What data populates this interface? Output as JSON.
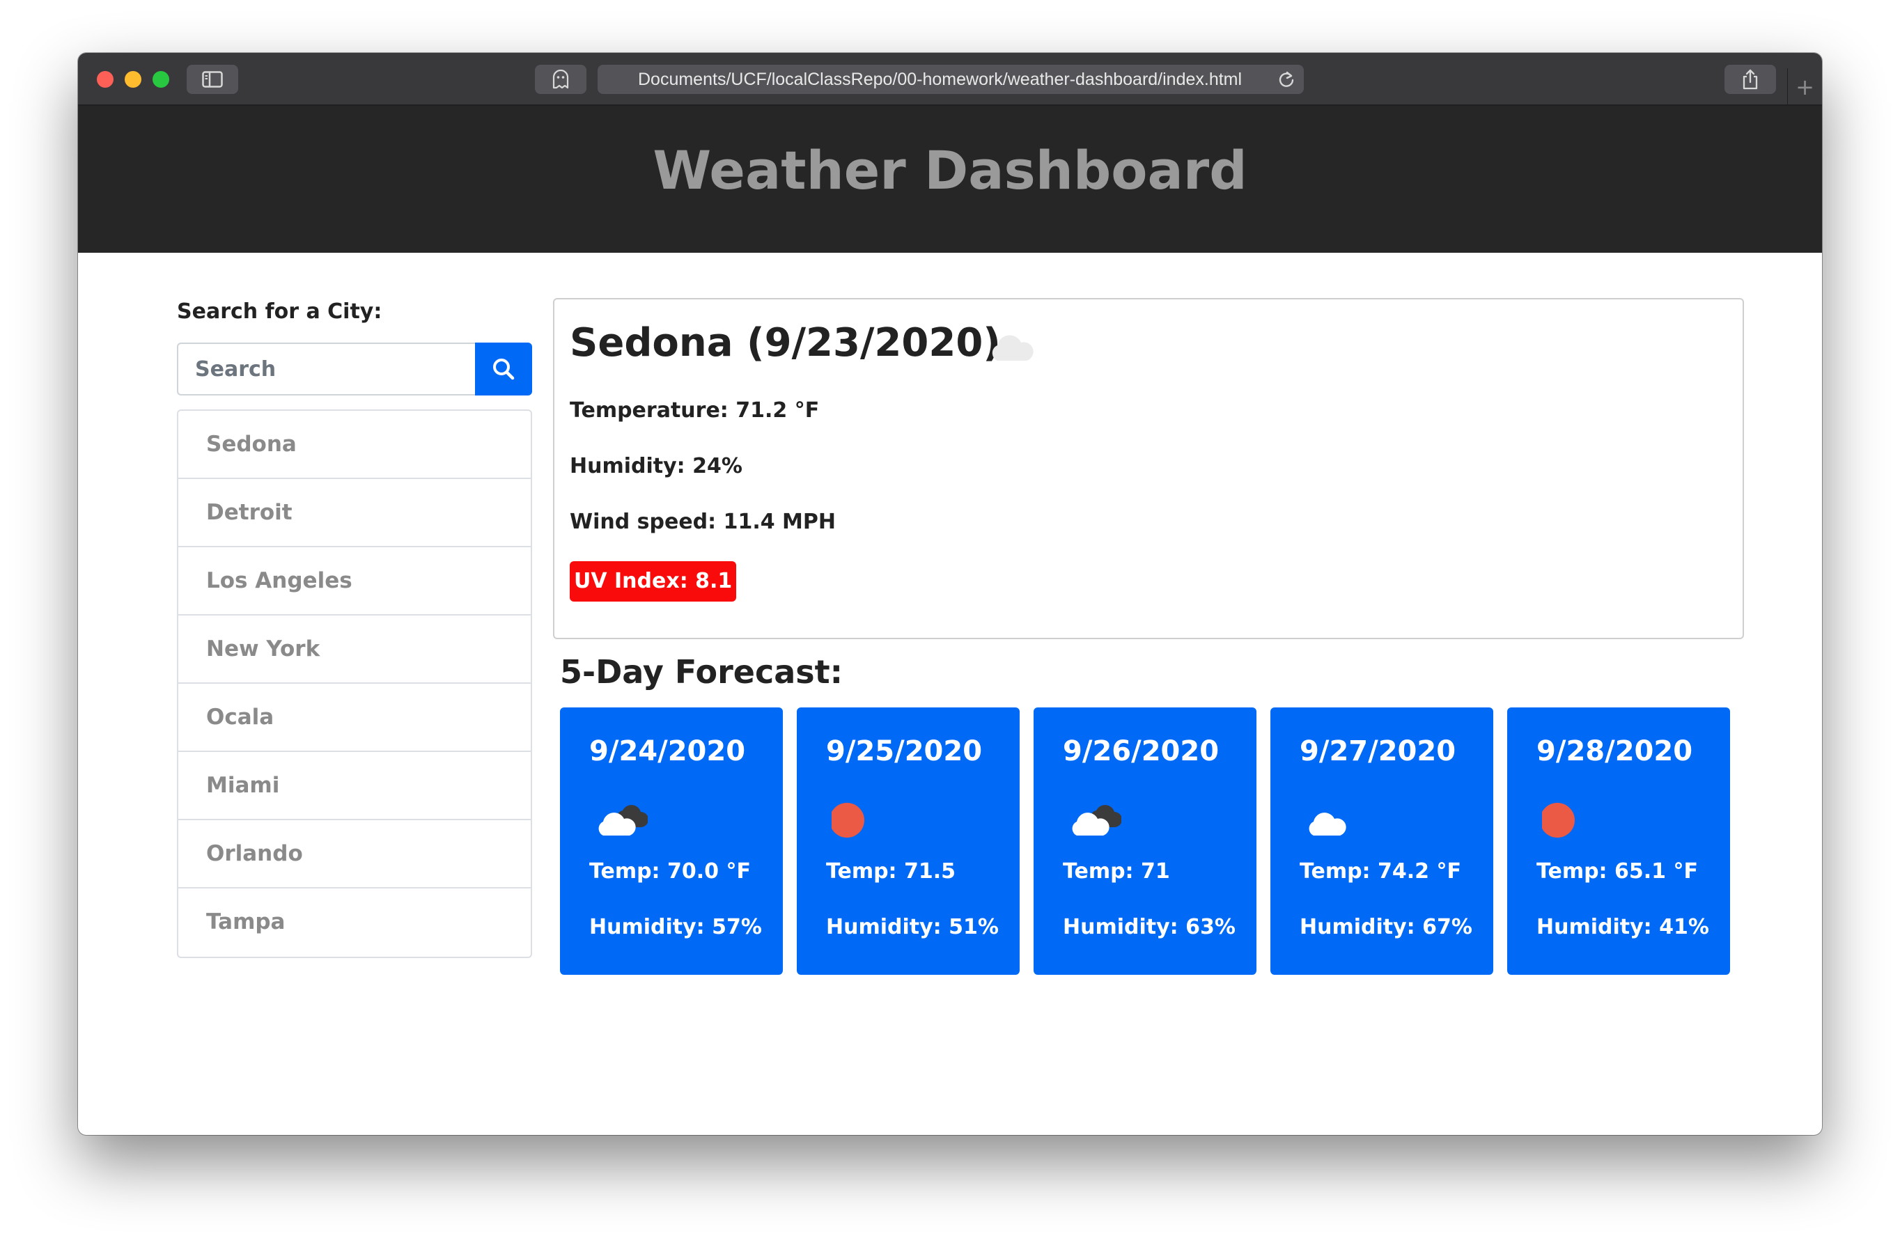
{
  "browser": {
    "url": "Documents/UCF/localClassRepo/00-homework/weather-dashboard/index.html",
    "new_tab_label": "+"
  },
  "header": {
    "title": "Weather Dashboard"
  },
  "search": {
    "label": "Search for a City:",
    "placeholder": "Search"
  },
  "cities": [
    "Sedona",
    "Detroit",
    "Los Angeles",
    "New York",
    "Ocala",
    "Miami",
    "Orlando",
    "Tampa"
  ],
  "current": {
    "title": "Sedona (9/23/2020)",
    "icon": "cloud-icon",
    "temperature": "Temperature: 71.2 °F",
    "humidity": "Humidity: 24%",
    "wind": "Wind speed: 11.4 MPH",
    "uv": "UV Index: 8.1",
    "uv_color": "#f90b0b"
  },
  "forecast": {
    "heading": "5-Day Forecast:",
    "card_color": "#0069f5",
    "days": [
      {
        "date": "9/24/2020",
        "icon": "cloudy-icon",
        "temp": "Temp: 70.0 °F",
        "humidity": "Humidity: 57%"
      },
      {
        "date": "9/25/2020",
        "icon": "sun-icon",
        "temp": "Temp: 71.5",
        "humidity": "Humidity: 51%"
      },
      {
        "date": "9/26/2020",
        "icon": "cloudy-icon",
        "temp": "Temp: 71",
        "humidity": "Humidity: 63%"
      },
      {
        "date": "9/27/2020",
        "icon": "cloud-icon",
        "temp": "Temp: 74.2 °F",
        "humidity": "Humidity: 67%"
      },
      {
        "date": "9/28/2020",
        "icon": "sun-icon",
        "temp": "Temp: 65.1 °F",
        "humidity": "Humidity: 41%"
      }
    ]
  }
}
